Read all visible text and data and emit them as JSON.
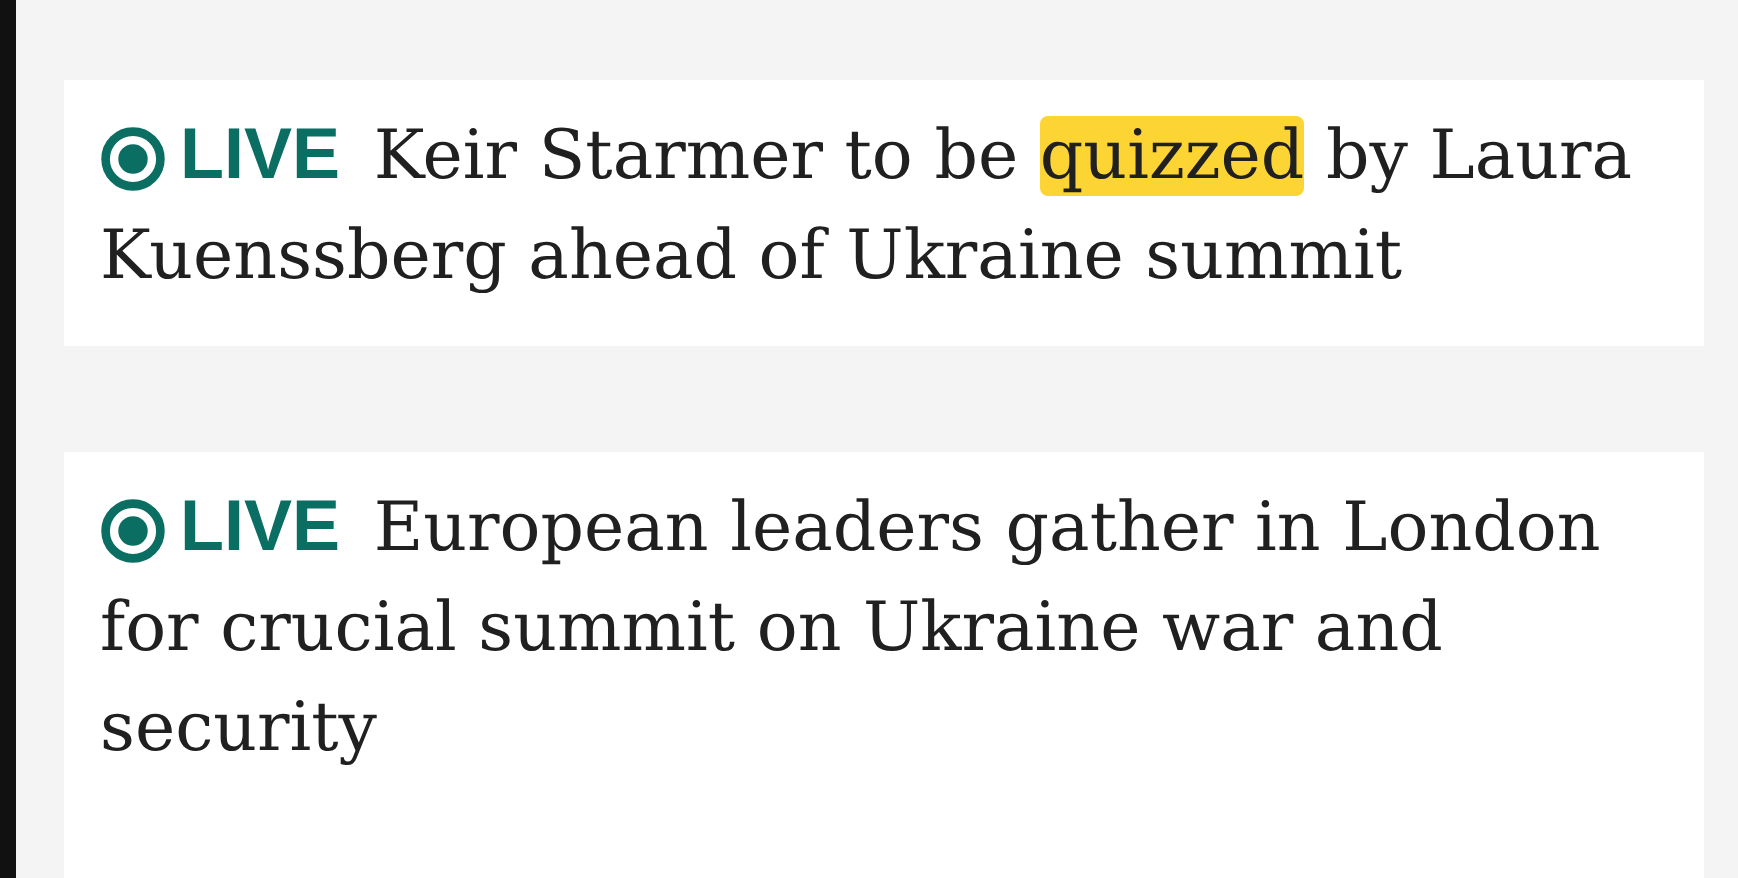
{
  "stories": [
    {
      "headline": [
        {
          "text": "**LIVE** Keir Starmer to be ",
          "highlighted": false
        },
        {
          "text": "quizzed",
          "highlighted": true
        },
        {
          "text": " by Laura Kuenssberg ahead of Ukraine summit",
          "highlighted": false
        }
      ]
    },
    {
      "headline": [
        {
          "text": "**LIVE** European leaders gather in London for crucial summit on Ukraine war and security",
          "highlighted": false
        }
      ]
    }
  ]
}
